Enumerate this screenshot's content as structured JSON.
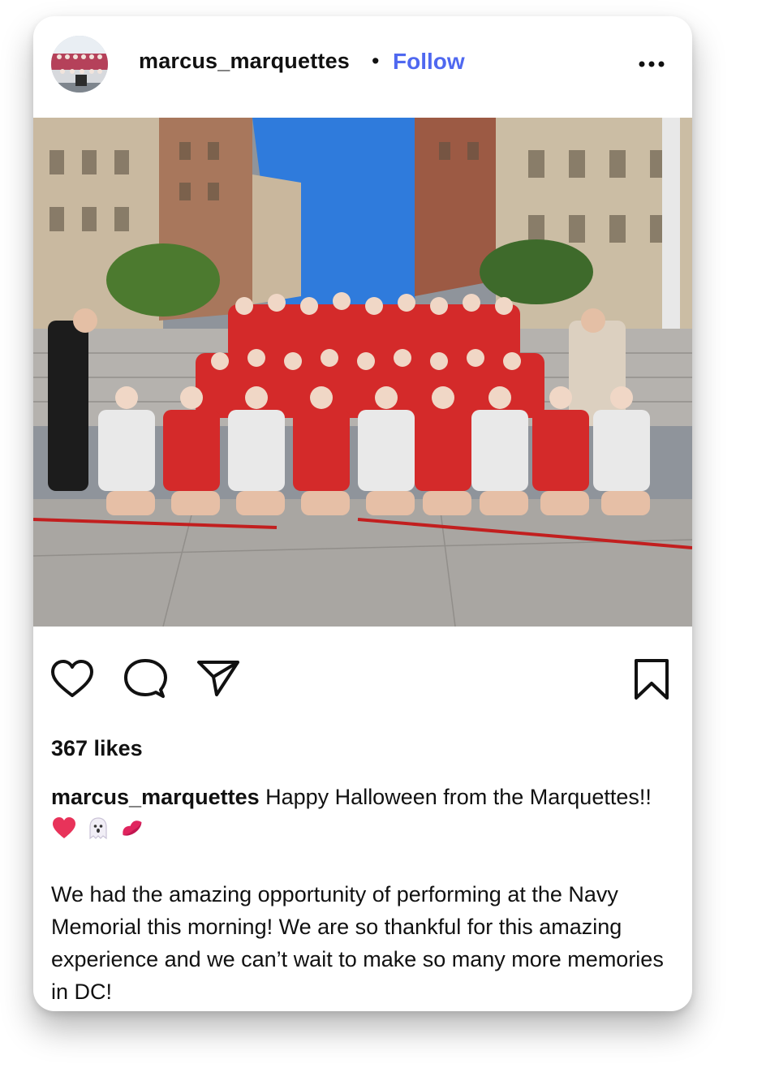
{
  "post": {
    "username": "marcus_marquettes",
    "separator": "•",
    "follow_label": "Follow",
    "more_icon": "more-horizontal-icon",
    "photo_icon": "group-photo",
    "actions": {
      "like_icon": "heart-icon",
      "comment_icon": "comment-icon",
      "share_icon": "send-icon",
      "save_icon": "bookmark-icon"
    },
    "likes": "367 likes",
    "caption": {
      "username": "marcus_marquettes",
      "line1": " Happy Halloween from the Marquettes!! ",
      "emojis": [
        "heart-emoji",
        "ghost-emoji",
        "kiss-mark-emoji"
      ],
      "paragraph2": "We had the amazing opportunity of performing at the Navy Memorial this morning! We are so thankful for this amazing experience and we can’t wait to make so many more memories in DC!"
    },
    "colors": {
      "follow": "#4f68f0",
      "text": "#111111",
      "sky": "#2f7bdc",
      "uniform_red": "#d42a2a"
    }
  }
}
